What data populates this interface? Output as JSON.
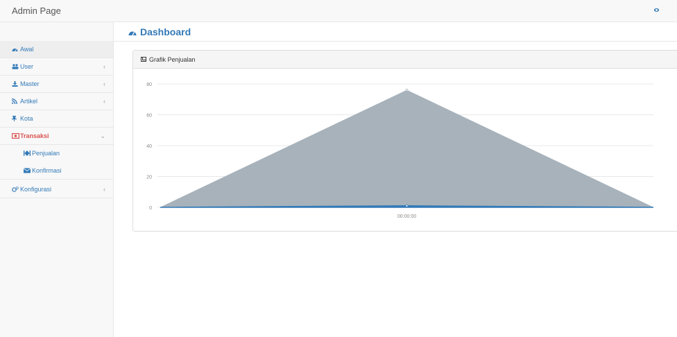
{
  "app": {
    "title": "Admin Page"
  },
  "sidebar": {
    "items": [
      {
        "label": "Awal",
        "icon": "dashboard-icon",
        "active": true
      },
      {
        "label": "User",
        "icon": "users-icon",
        "chevron": "‹"
      },
      {
        "label": "Master",
        "icon": "download-icon",
        "chevron": "‹"
      },
      {
        "label": "Artikel",
        "icon": "rss-icon",
        "chevron": "‹"
      },
      {
        "label": "Kota",
        "icon": "thumbtack-icon"
      },
      {
        "label": "Transaksi",
        "icon": "money-icon",
        "chevron": "⌄",
        "open": true
      },
      {
        "label": "Penjualan",
        "icon": "fast-forward-icon",
        "sub": true
      },
      {
        "label": "Konfirmasi",
        "icon": "envelope-icon",
        "sub": true
      },
      {
        "label": "Konfigurasi",
        "icon": "cogs-icon",
        "chevron": "‹"
      }
    ]
  },
  "main": {
    "title": "Dashboard",
    "panel": {
      "title": "Grafik Penjualan"
    }
  },
  "colors": {
    "accent": "#337ab7",
    "area": "#a7b2bb",
    "open": "#d9534f"
  },
  "chart_data": {
    "type": "area",
    "x": [
      "",
      "00:00:00",
      ""
    ],
    "series": [
      {
        "values": [
          0,
          76,
          0
        ],
        "color": "#a7b2bb"
      },
      {
        "values": [
          0,
          1,
          0
        ],
        "color": "#337ab7"
      }
    ],
    "yticks": [
      0,
      20,
      40,
      60,
      80
    ],
    "ylim": [
      0,
      80
    ],
    "grid": true
  }
}
